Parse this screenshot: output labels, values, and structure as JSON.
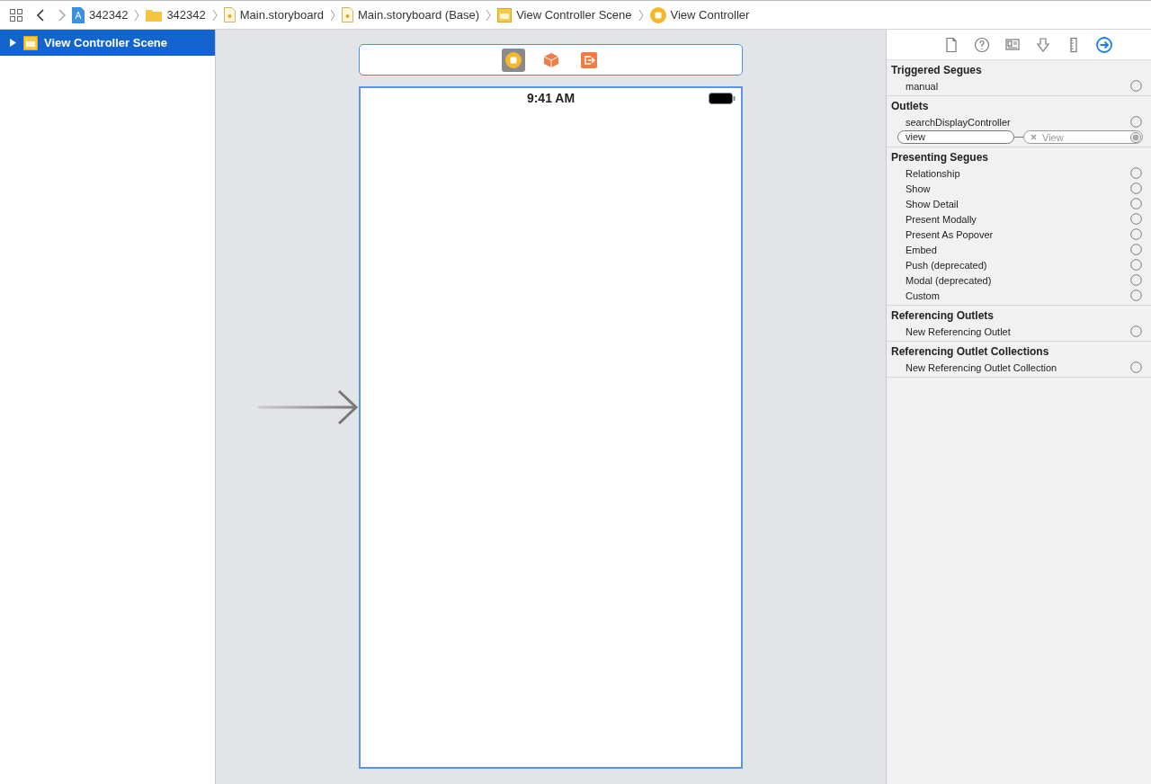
{
  "breadcrumbs": [
    {
      "kind": "project",
      "label": "342342"
    },
    {
      "kind": "folder",
      "label": "342342"
    },
    {
      "kind": "storyboard",
      "label": "Main.storyboard"
    },
    {
      "kind": "storyboard",
      "label": "Main.storyboard (Base)"
    },
    {
      "kind": "scene",
      "label": "View Controller Scene"
    },
    {
      "kind": "controller",
      "label": "View Controller"
    }
  ],
  "outline": [
    {
      "label": "View Controller Scene",
      "selected": true,
      "expanded": false
    }
  ],
  "scene_dock": [
    {
      "kind": "controller",
      "selected": true
    },
    {
      "kind": "first-responder",
      "selected": false
    },
    {
      "kind": "exit",
      "selected": false
    }
  ],
  "device": {
    "status_time": "9:41 AM",
    "initial_arrow": true
  },
  "inspector_tabs": [
    {
      "kind": "file",
      "selected": false
    },
    {
      "kind": "help",
      "selected": false
    },
    {
      "kind": "identity",
      "selected": false
    },
    {
      "kind": "attributes",
      "selected": false
    },
    {
      "kind": "size",
      "selected": false
    },
    {
      "kind": "connections",
      "selected": true
    }
  ],
  "sections": [
    {
      "title": "Triggered Segues",
      "rows": [
        {
          "label": "manual",
          "connected": false
        }
      ]
    },
    {
      "title": "Outlets",
      "rows": [
        {
          "label": "searchDisplayController",
          "connected": false
        },
        {
          "label": "view",
          "connected": true,
          "target": "View"
        }
      ]
    },
    {
      "title": "Presenting Segues",
      "rows": [
        {
          "label": "Relationship",
          "connected": false
        },
        {
          "label": "Show",
          "connected": false
        },
        {
          "label": "Show Detail",
          "connected": false
        },
        {
          "label": "Present Modally",
          "connected": false
        },
        {
          "label": "Present As Popover",
          "connected": false
        },
        {
          "label": "Embed",
          "connected": false
        },
        {
          "label": "Push (deprecated)",
          "connected": false
        },
        {
          "label": "Modal (deprecated)",
          "connected": false
        },
        {
          "label": "Custom",
          "connected": false
        }
      ]
    },
    {
      "title": "Referencing Outlets",
      "rows": [
        {
          "label": "New Referencing Outlet",
          "connected": false
        }
      ]
    },
    {
      "title": "Referencing Outlet Collections",
      "rows": [
        {
          "label": "New Referencing Outlet Collection",
          "connected": false
        }
      ]
    }
  ]
}
